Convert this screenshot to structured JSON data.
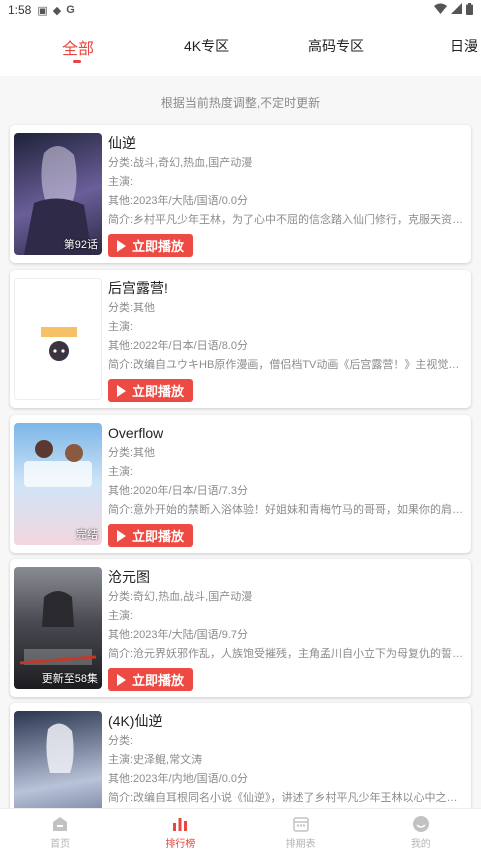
{
  "status": {
    "time": "1:58",
    "left_icons": [
      "notification-icon",
      "android-icon",
      "google-icon"
    ],
    "right_icons": [
      "wifi-icon",
      "signal-icon",
      "battery-icon"
    ]
  },
  "tabs": [
    {
      "label": "全部",
      "active": true
    },
    {
      "label": "4K专区",
      "active": false
    },
    {
      "label": "高码专区",
      "active": false
    },
    {
      "label": "日漫",
      "active": false
    }
  ],
  "notice": "根据当前热度调整,不定时更新",
  "play_label": "立即播放",
  "items": [
    {
      "title": "仙逆",
      "category": "分类:战斗,奇幻,热血,国产动漫",
      "cast": "主演:",
      "other": "其他:2023年/大陆/国语/0.0分",
      "intro": "简介:乡村平凡少年王林，为了心中不屈的信念踏入仙门修行，克服天资不足...",
      "badge": "第92话",
      "poster_colors": [
        "#1d2238",
        "#6b5e9a"
      ]
    },
    {
      "title": "后宫露营!",
      "category": "分类:其他",
      "cast": "主演:",
      "other": "其他:2022年/日本/日语/8.0分",
      "intro": "简介:改编自ユウキHB原作漫画，僧侣档TV动画《后宫露营！》主视觉图公...",
      "badge": "",
      "poster_colors": [
        "#ffffff",
        "#f3f3f3"
      ]
    },
    {
      "title": "Overflow",
      "category": "分类:其他",
      "cast": "主演:",
      "other": "其他:2020年/日本/日语/7.3分",
      "intro": "简介:意外开始的禁断入浴体验！好姐妹和青梅竹马的哥哥，如果你的肩膀也...",
      "badge": "完结",
      "poster_colors": [
        "#7cb6e8",
        "#f2d6de"
      ]
    },
    {
      "title": "沧元图",
      "category": "分类:奇幻,热血,战斗,国产动漫",
      "cast": "主演:",
      "other": "其他:2023年/大陆/国语/9.7分",
      "intro": "简介:沧元界妖邪作乱，人族饱受摧残，主角孟川自小立下为母复仇的誓言，...",
      "badge": "更新至58集",
      "poster_colors": [
        "#2b2b30",
        "#8a8c94"
      ]
    },
    {
      "title": "(4K)仙逆",
      "category": "分类:",
      "cast": "主演:史泽鲲,常文涛",
      "other": "其他:2023年/内地/国语/0.0分",
      "intro": "简介:改编自耳根同名小说《仙逆》，讲述了乡村平凡少年王林以心中之感动...",
      "badge": "",
      "poster_colors": [
        "#2a3550",
        "#b8c2d8"
      ]
    }
  ],
  "bottom_nav": [
    {
      "label": "首页",
      "icon": "home-icon",
      "active": false
    },
    {
      "label": "排行榜",
      "icon": "ranking-icon",
      "active": true
    },
    {
      "label": "排期表",
      "icon": "calendar-icon",
      "active": false
    },
    {
      "label": "我的",
      "icon": "profile-icon",
      "active": false
    }
  ]
}
